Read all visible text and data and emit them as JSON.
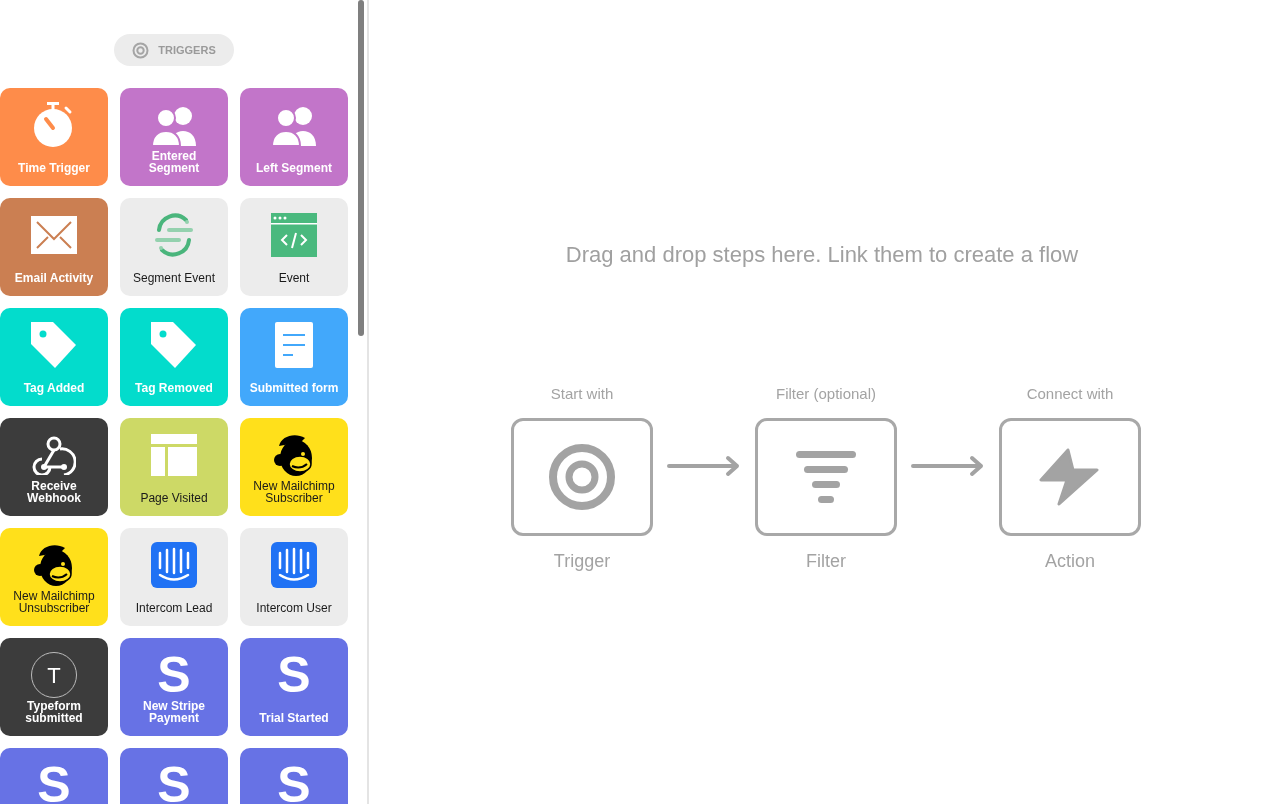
{
  "sidebar": {
    "header": {
      "label": "TRIGGERS"
    },
    "tiles": [
      {
        "kind": "stopwatch",
        "label": "Time Trigger",
        "color": "#fe8c4a"
      },
      {
        "kind": "people",
        "label": "Entered Segment",
        "color": "#c275c9"
      },
      {
        "kind": "people",
        "label": "Left Segment",
        "color": "#c275c9"
      },
      {
        "kind": "envelope",
        "label": "Email Activity",
        "color": "#cb7f52"
      },
      {
        "kind": "segment",
        "label": "Segment Event",
        "color": "#ececec"
      },
      {
        "kind": "code-window",
        "label": "Event",
        "color": "#ececec"
      },
      {
        "kind": "tag",
        "label": "Tag Added",
        "color": "#03dccc"
      },
      {
        "kind": "tag",
        "label": "Tag Removed",
        "color": "#03dccc"
      },
      {
        "kind": "document",
        "label": "Submitted form",
        "color": "#42a8fb"
      },
      {
        "kind": "webhook",
        "label": "Receive Webhook",
        "color": "#3c3c3c"
      },
      {
        "kind": "layout",
        "label": "Page Visited",
        "color": "#cdd966"
      },
      {
        "kind": "monkey",
        "label": "New Mailchimp Subscriber",
        "color": "#ffe01b"
      },
      {
        "kind": "monkey",
        "label": "New Mailchimp Unsubscriber",
        "color": "#ffe01b"
      },
      {
        "kind": "chat",
        "label": "Intercom Lead",
        "color": "#ececec"
      },
      {
        "kind": "chat",
        "label": "Intercom User",
        "color": "#ececec"
      },
      {
        "kind": "letter",
        "glyph": "T",
        "label": "Typeform submitted",
        "color": "#3c3c3c"
      },
      {
        "kind": "letter-bold",
        "glyph": "S",
        "label": "New Stripe Payment",
        "color": "#6772e5"
      },
      {
        "kind": "letter-bold",
        "glyph": "S",
        "label": "Trial Started",
        "color": "#6772e5"
      },
      {
        "kind": "letter-bold",
        "glyph": "S",
        "color": "#6772e5"
      },
      {
        "kind": "letter-bold",
        "glyph": "S",
        "color": "#6772e5"
      },
      {
        "kind": "letter-bold",
        "glyph": "S",
        "color": "#6772e5"
      }
    ]
  },
  "canvas": {
    "hint": "Drag and drop steps here. Link them to create a flow",
    "steps": [
      {
        "kind": "trigger",
        "caption": "Start with",
        "label": "Trigger"
      },
      {
        "kind": "filter",
        "caption": "Filter (optional)",
        "label": "Filter"
      },
      {
        "kind": "action",
        "caption": "Connect with",
        "label": "Action"
      }
    ]
  }
}
